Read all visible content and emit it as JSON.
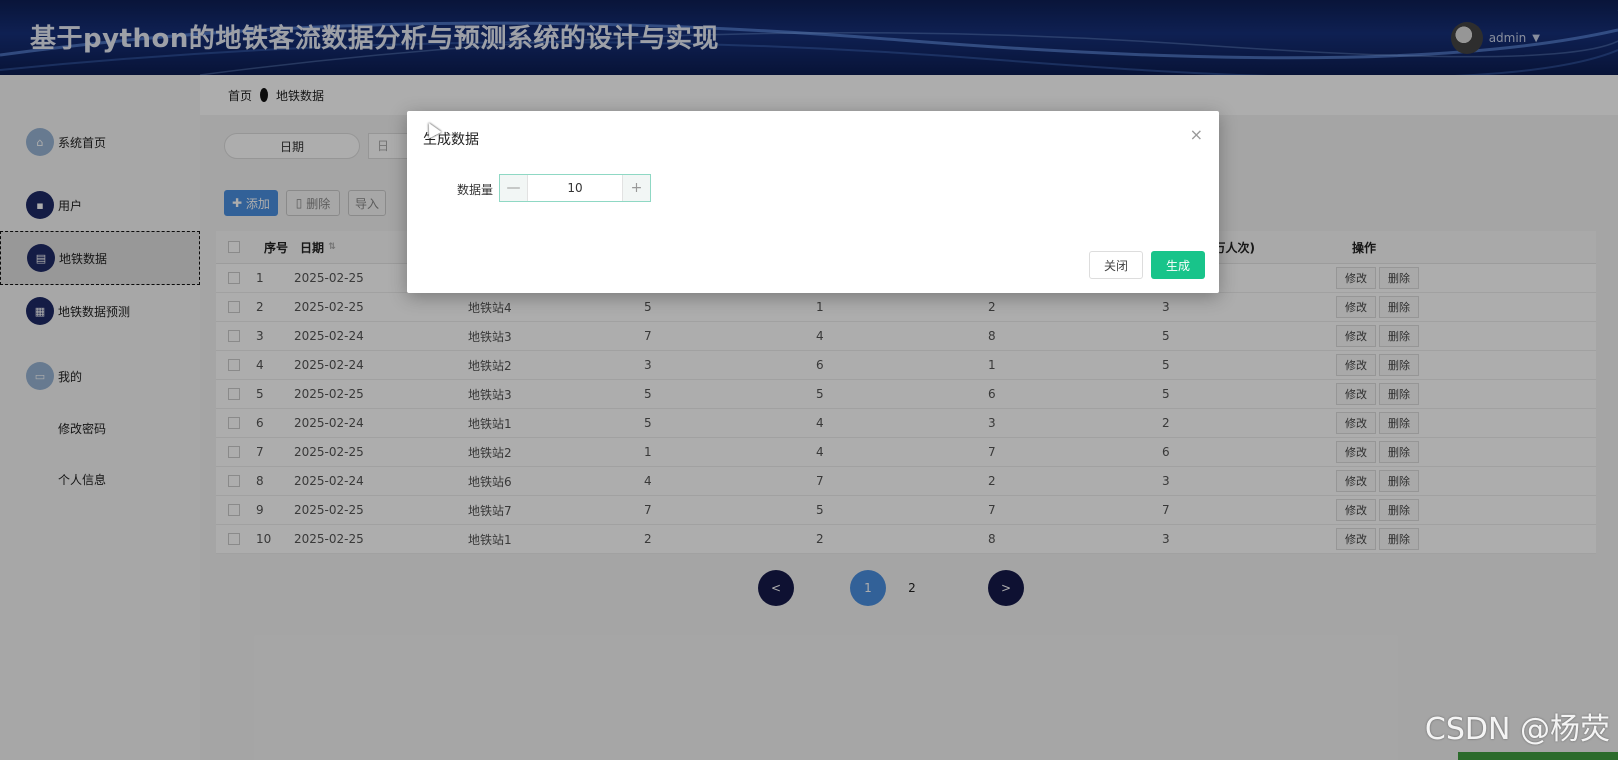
{
  "header": {
    "title": "基于python的地铁客流数据分析与预测系统的设计与实现",
    "username": "admin"
  },
  "sidebar": {
    "items": [
      {
        "label": "系统首页",
        "icon": "home-icon"
      },
      {
        "label": "用户",
        "icon": "user-icon"
      },
      {
        "label": "地铁数据",
        "icon": "chart-icon"
      },
      {
        "label": "地铁数据预测",
        "icon": "grid-icon"
      },
      {
        "label": "我的",
        "icon": "profile-icon"
      }
    ],
    "subitems": [
      "修改密码",
      "个人信息"
    ]
  },
  "breadcrumb": {
    "home": "首页",
    "current": "地铁数据"
  },
  "search": {
    "date_label": "日期",
    "date_placeholder": "日"
  },
  "toolbar": {
    "add": "添加",
    "delete": "删除",
    "import": "导入"
  },
  "table": {
    "columns": [
      "序号",
      "日期",
      "量(万人次)",
      "操作"
    ],
    "rows": [
      [
        "1",
        "2025-02-25",
        "",
        "",
        "",
        "",
        ""
      ],
      [
        "2",
        "2025-02-25",
        "地铁站4",
        "5",
        "1",
        "2",
        "3"
      ],
      [
        "3",
        "2025-02-24",
        "地铁站3",
        "7",
        "4",
        "8",
        "5"
      ],
      [
        "4",
        "2025-02-24",
        "地铁站2",
        "3",
        "6",
        "1",
        "5"
      ],
      [
        "5",
        "2025-02-25",
        "地铁站3",
        "5",
        "5",
        "6",
        "5"
      ],
      [
        "6",
        "2025-02-24",
        "地铁站1",
        "5",
        "4",
        "3",
        "2"
      ],
      [
        "7",
        "2025-02-25",
        "地铁站2",
        "1",
        "4",
        "7",
        "6"
      ],
      [
        "8",
        "2025-02-24",
        "地铁站6",
        "4",
        "7",
        "2",
        "3"
      ],
      [
        "9",
        "2025-02-25",
        "地铁站7",
        "7",
        "5",
        "7",
        "7"
      ],
      [
        "10",
        "2025-02-25",
        "地铁站1",
        "2",
        "2",
        "8",
        "3"
      ]
    ],
    "edit_label": "修改",
    "delete_label": "删除"
  },
  "pagination": {
    "prev": "<",
    "current": "1",
    "next_page": "2",
    "next": ">"
  },
  "modal": {
    "title": "生成数据",
    "field_label": "数据量",
    "value": "10",
    "minus": "—",
    "plus": "+",
    "close_label": "关闭",
    "generate_label": "生成",
    "close_icon": "×"
  },
  "watermark": "CSDN @杨荧"
}
